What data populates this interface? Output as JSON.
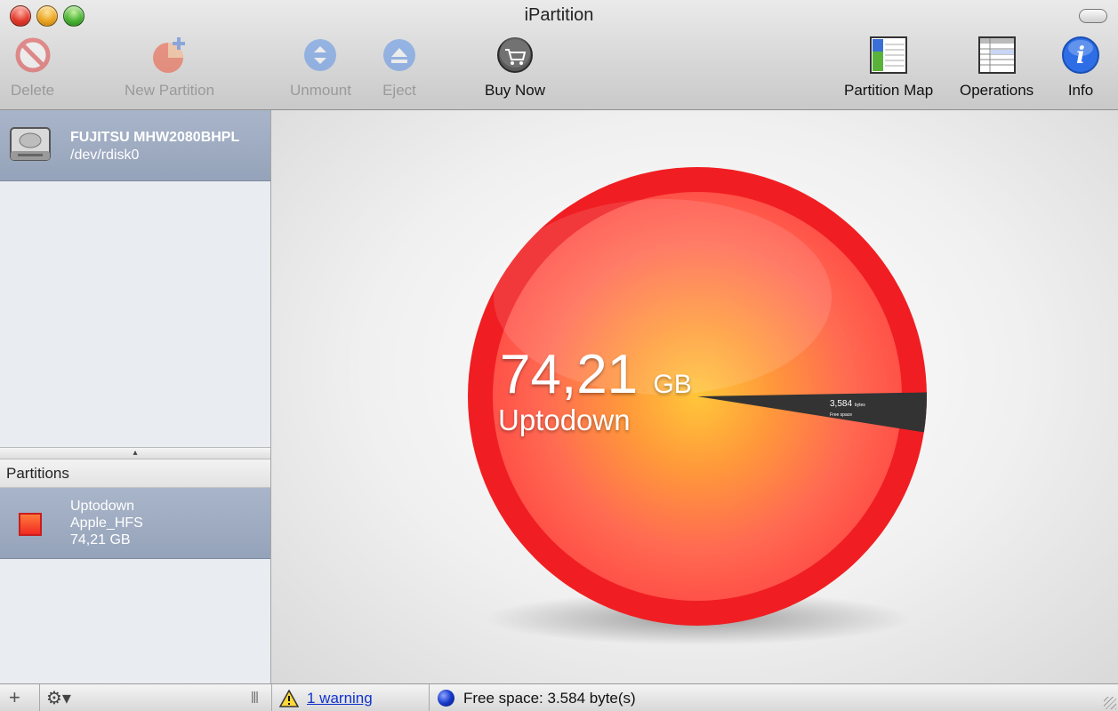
{
  "window": {
    "title": "iPartition"
  },
  "toolbar": {
    "delete": "Delete",
    "new_partition": "New Partition",
    "unmount": "Unmount",
    "eject": "Eject",
    "buy_now": "Buy Now",
    "partition_map": "Partition Map",
    "operations": "Operations",
    "info": "Info"
  },
  "sidebar": {
    "disk": {
      "name": "FUJITSU MHW2080BHPL",
      "device": "/dev/rdisk0"
    },
    "partitions_header": "Partitions",
    "partitions": [
      {
        "name": "Uptodown",
        "type": "Apple_HFS",
        "size": "74,21 GB"
      }
    ]
  },
  "chart_data": {
    "type": "pie",
    "slices": [
      {
        "label": "Uptodown",
        "value": 74.21,
        "unit": "GB",
        "color": "#f01e22"
      },
      {
        "label": "Free space",
        "value": 3584,
        "unit": "bytes",
        "color": "#333333"
      }
    ],
    "center_label": {
      "size_value": "74,21",
      "size_unit": "GB",
      "name": "Uptodown"
    },
    "slice_label": {
      "value": "3,584",
      "unit": "bytes",
      "text": "Free space"
    }
  },
  "statusbar": {
    "warning": "1 warning",
    "free_space": "Free space: 3.584 byte(s)"
  }
}
